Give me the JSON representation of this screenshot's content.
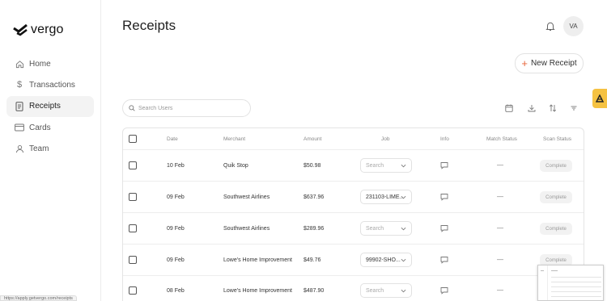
{
  "app": {
    "brand": "vergo"
  },
  "sidebar": {
    "items": [
      {
        "label": "Home",
        "icon": "home-icon"
      },
      {
        "label": "Transactions",
        "icon": "dollar-icon"
      },
      {
        "label": "Receipts",
        "icon": "receipt-icon",
        "active": true
      },
      {
        "label": "Cards",
        "icon": "card-icon"
      },
      {
        "label": "Team",
        "icon": "user-icon"
      }
    ]
  },
  "header": {
    "title": "Receipts",
    "avatar_initials": "VA",
    "new_receipt_label": "New Receipt"
  },
  "toolbar": {
    "search_placeholder": "Search Users",
    "tools": [
      "calendar-icon",
      "download-icon",
      "sort-icon",
      "filter-icon"
    ]
  },
  "table": {
    "columns": [
      "Date",
      "Merchant",
      "Amount",
      "Job",
      "Info",
      "Match Status",
      "Scan Status"
    ],
    "rows": [
      {
        "date": "10 Feb",
        "merchant": "Quik Stop",
        "amount": "$50.98",
        "job": "Search",
        "job_empty": true,
        "match": "—",
        "scan": "Complete"
      },
      {
        "date": "09 Feb",
        "merchant": "Southwest Airlines",
        "amount": "$637.96",
        "job": "231103-LIME...",
        "job_empty": false,
        "match": "—",
        "scan": "Complete"
      },
      {
        "date": "09 Feb",
        "merchant": "Southwest Airlines",
        "amount": "$289.96",
        "job": "Search",
        "job_empty": true,
        "match": "—",
        "scan": "Complete"
      },
      {
        "date": "09 Feb",
        "merchant": "Lowe's Home Improvement",
        "amount": "$49.76",
        "job": "99902-SHO...",
        "job_empty": false,
        "match": "—",
        "scan": "Complete"
      },
      {
        "date": "08 Feb",
        "merchant": "Lowe's Home Improvement",
        "amount": "$487.90",
        "job": "Search",
        "job_empty": true,
        "match": "—",
        "scan": ""
      }
    ]
  },
  "status_bar": {
    "url": "https://apply.getvergo.com/receipts"
  },
  "colors": {
    "accent": "#e8643a",
    "side_tab": "#f5c242"
  }
}
